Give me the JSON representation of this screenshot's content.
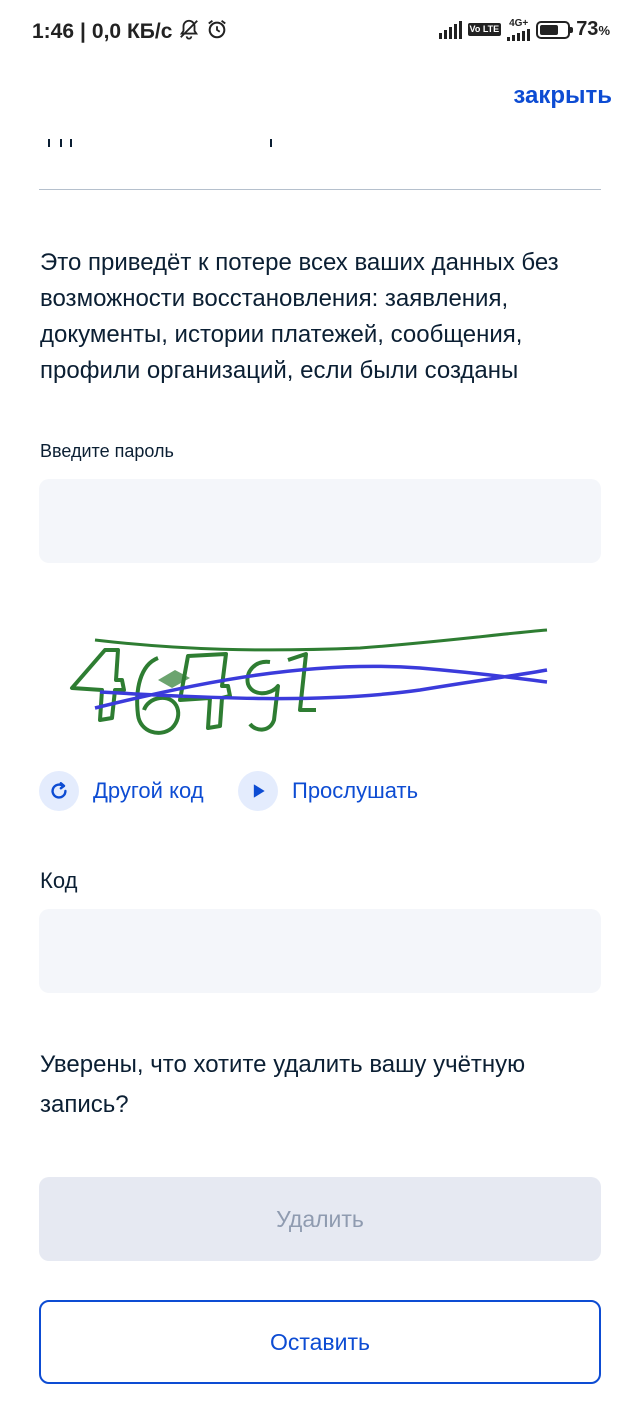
{
  "status_bar": {
    "time": "1:46",
    "network_speed": "0,0 КБ/с",
    "network_type": "4G+",
    "volte": "Vo LTE",
    "battery_percent": "73",
    "battery_unit": "%",
    "battery_level": 0.73,
    "icons": [
      "bell-off-icon",
      "alarm-icon",
      "signal-icon",
      "volte-icon",
      "signal-4g-icon",
      "battery-icon"
    ]
  },
  "header": {
    "close_label": "закрыть"
  },
  "warning_text": "Это приведёт к потере всех ваших данных без возможности восстановления: заявления, документы, истории платежей, сообщения, профили организаций, если были созданы",
  "password": {
    "label": "Введите пароль",
    "value": "",
    "placeholder": ""
  },
  "captcha": {
    "refresh_label": "Другой код",
    "listen_label": "Прослушать",
    "refresh_icon": "refresh-icon",
    "listen_icon": "play-icon",
    "colors": {
      "strokes_green": "#2e7d32",
      "strokes_blue": "#3b3bdb"
    }
  },
  "code": {
    "label": "Код",
    "value": "",
    "placeholder": ""
  },
  "confirm_question": "Уверены, что хотите удалить вашу учётную запись?",
  "actions": {
    "delete_label": "Удалить",
    "keep_label": "Оставить"
  },
  "colors": {
    "accent": "#0d4cd3",
    "input_bg": "#f4f6fa",
    "disabled_bg": "#e6e9f2",
    "disabled_text": "#8f9bb0"
  }
}
